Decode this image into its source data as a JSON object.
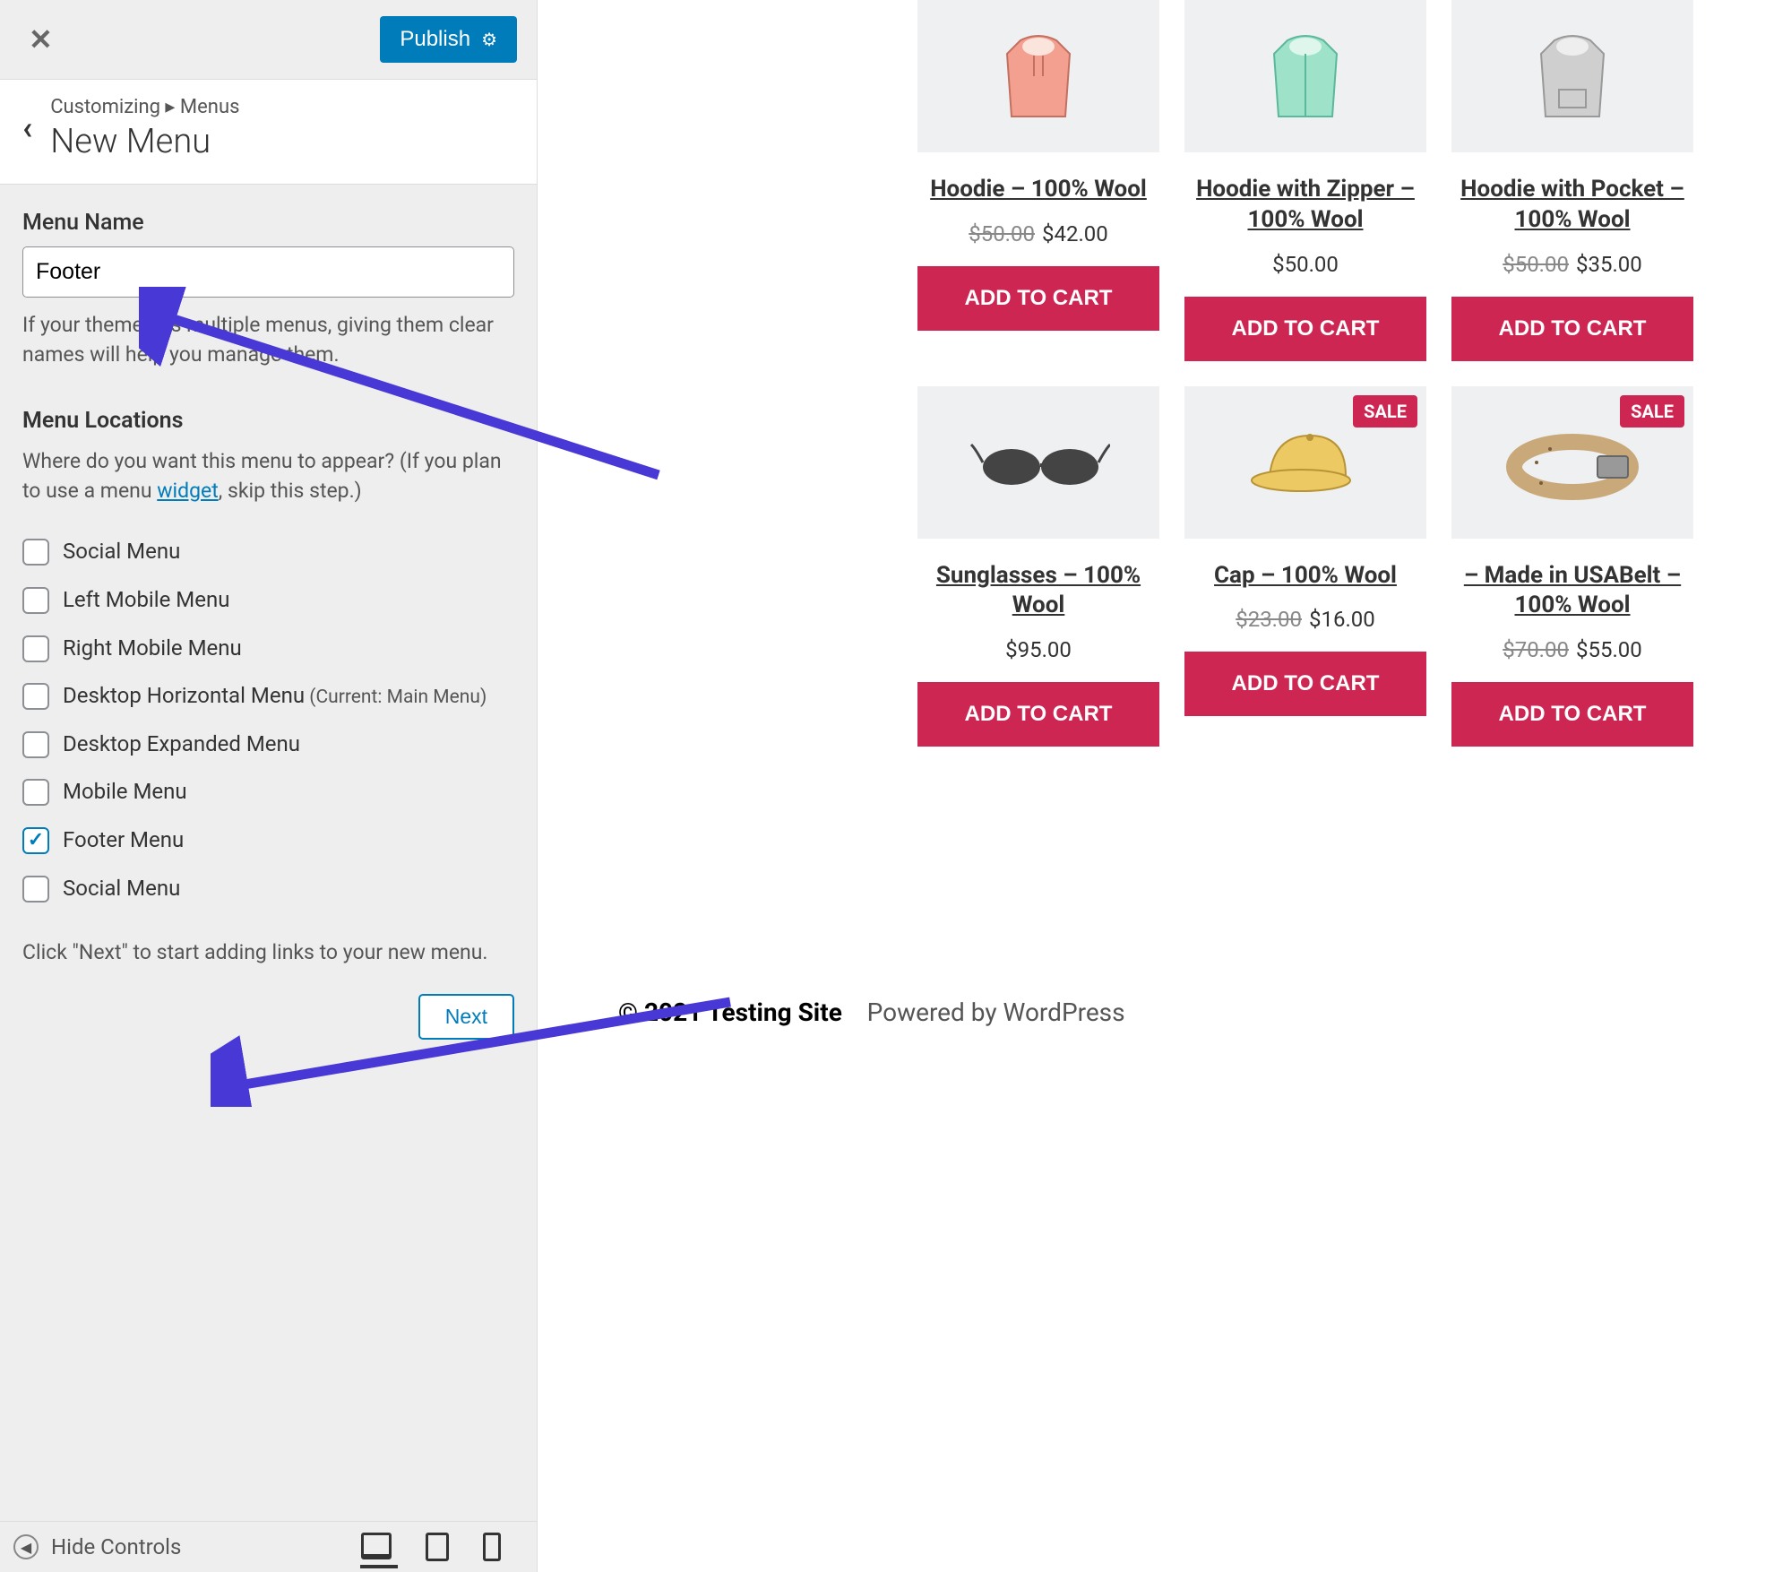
{
  "topbar": {
    "publish": "Publish"
  },
  "breadcrumb": {
    "crumb": "Customizing ▸ Menus",
    "title": "New Menu"
  },
  "menu_name": {
    "label": "Menu Name",
    "value": "Footer",
    "help": "If your theme has multiple menus, giving them clear names will help you manage them."
  },
  "locations": {
    "heading": "Menu Locations",
    "desc_before": "Where do you want this menu to appear? (If you plan to use a menu ",
    "desc_link": "widget",
    "desc_after": ", skip this step.)",
    "items": [
      {
        "label": "Social Menu",
        "checked": false
      },
      {
        "label": "Left Mobile Menu",
        "checked": false
      },
      {
        "label": "Right Mobile Menu",
        "checked": false
      },
      {
        "label": "Desktop Horizontal Menu",
        "note": "(Current: Main Menu)",
        "checked": false
      },
      {
        "label": "Desktop Expanded Menu",
        "checked": false
      },
      {
        "label": "Mobile Menu",
        "checked": false
      },
      {
        "label": "Footer Menu",
        "checked": true
      },
      {
        "label": "Social Menu",
        "checked": false
      }
    ],
    "next_help": "Click \"Next\" to start adding links to your new menu.",
    "next": "Next"
  },
  "bottombar": {
    "hide": "Hide Controls"
  },
  "products": [
    {
      "title": "Hoodie – 100% Wool",
      "old": "$50.00",
      "price": "$42.00",
      "btn": "ADD TO CART",
      "sale": false,
      "img": "hoodie1"
    },
    {
      "title": "Hoodie with Zipper – 100% Wool",
      "price": "$50.00",
      "btn": "ADD TO CART",
      "sale": false,
      "img": "hoodie2"
    },
    {
      "title": "Hoodie with Pocket – 100% Wool",
      "old": "$50.00",
      "price": "$35.00",
      "btn": "ADD TO CART",
      "sale": false,
      "img": "hoodie3"
    },
    {
      "title": "Sunglasses – 100% Wool",
      "price": "$95.00",
      "btn": "ADD TO CART",
      "sale": false,
      "img": "sunglasses"
    },
    {
      "title": "Cap – 100% Wool",
      "old": "$23.00",
      "price": "$16.00",
      "btn": "ADD TO CART",
      "sale": true,
      "sale_label": "SALE",
      "img": "cap"
    },
    {
      "title": "– Made in USABelt – 100% Wool",
      "old": "$70.00",
      "price": "$55.00",
      "btn": "ADD TO CART",
      "sale": true,
      "sale_label": "SALE",
      "img": "belt"
    }
  ],
  "footer": {
    "site": "© 2021 Testing Site",
    "powered": "Powered by WordPress"
  }
}
